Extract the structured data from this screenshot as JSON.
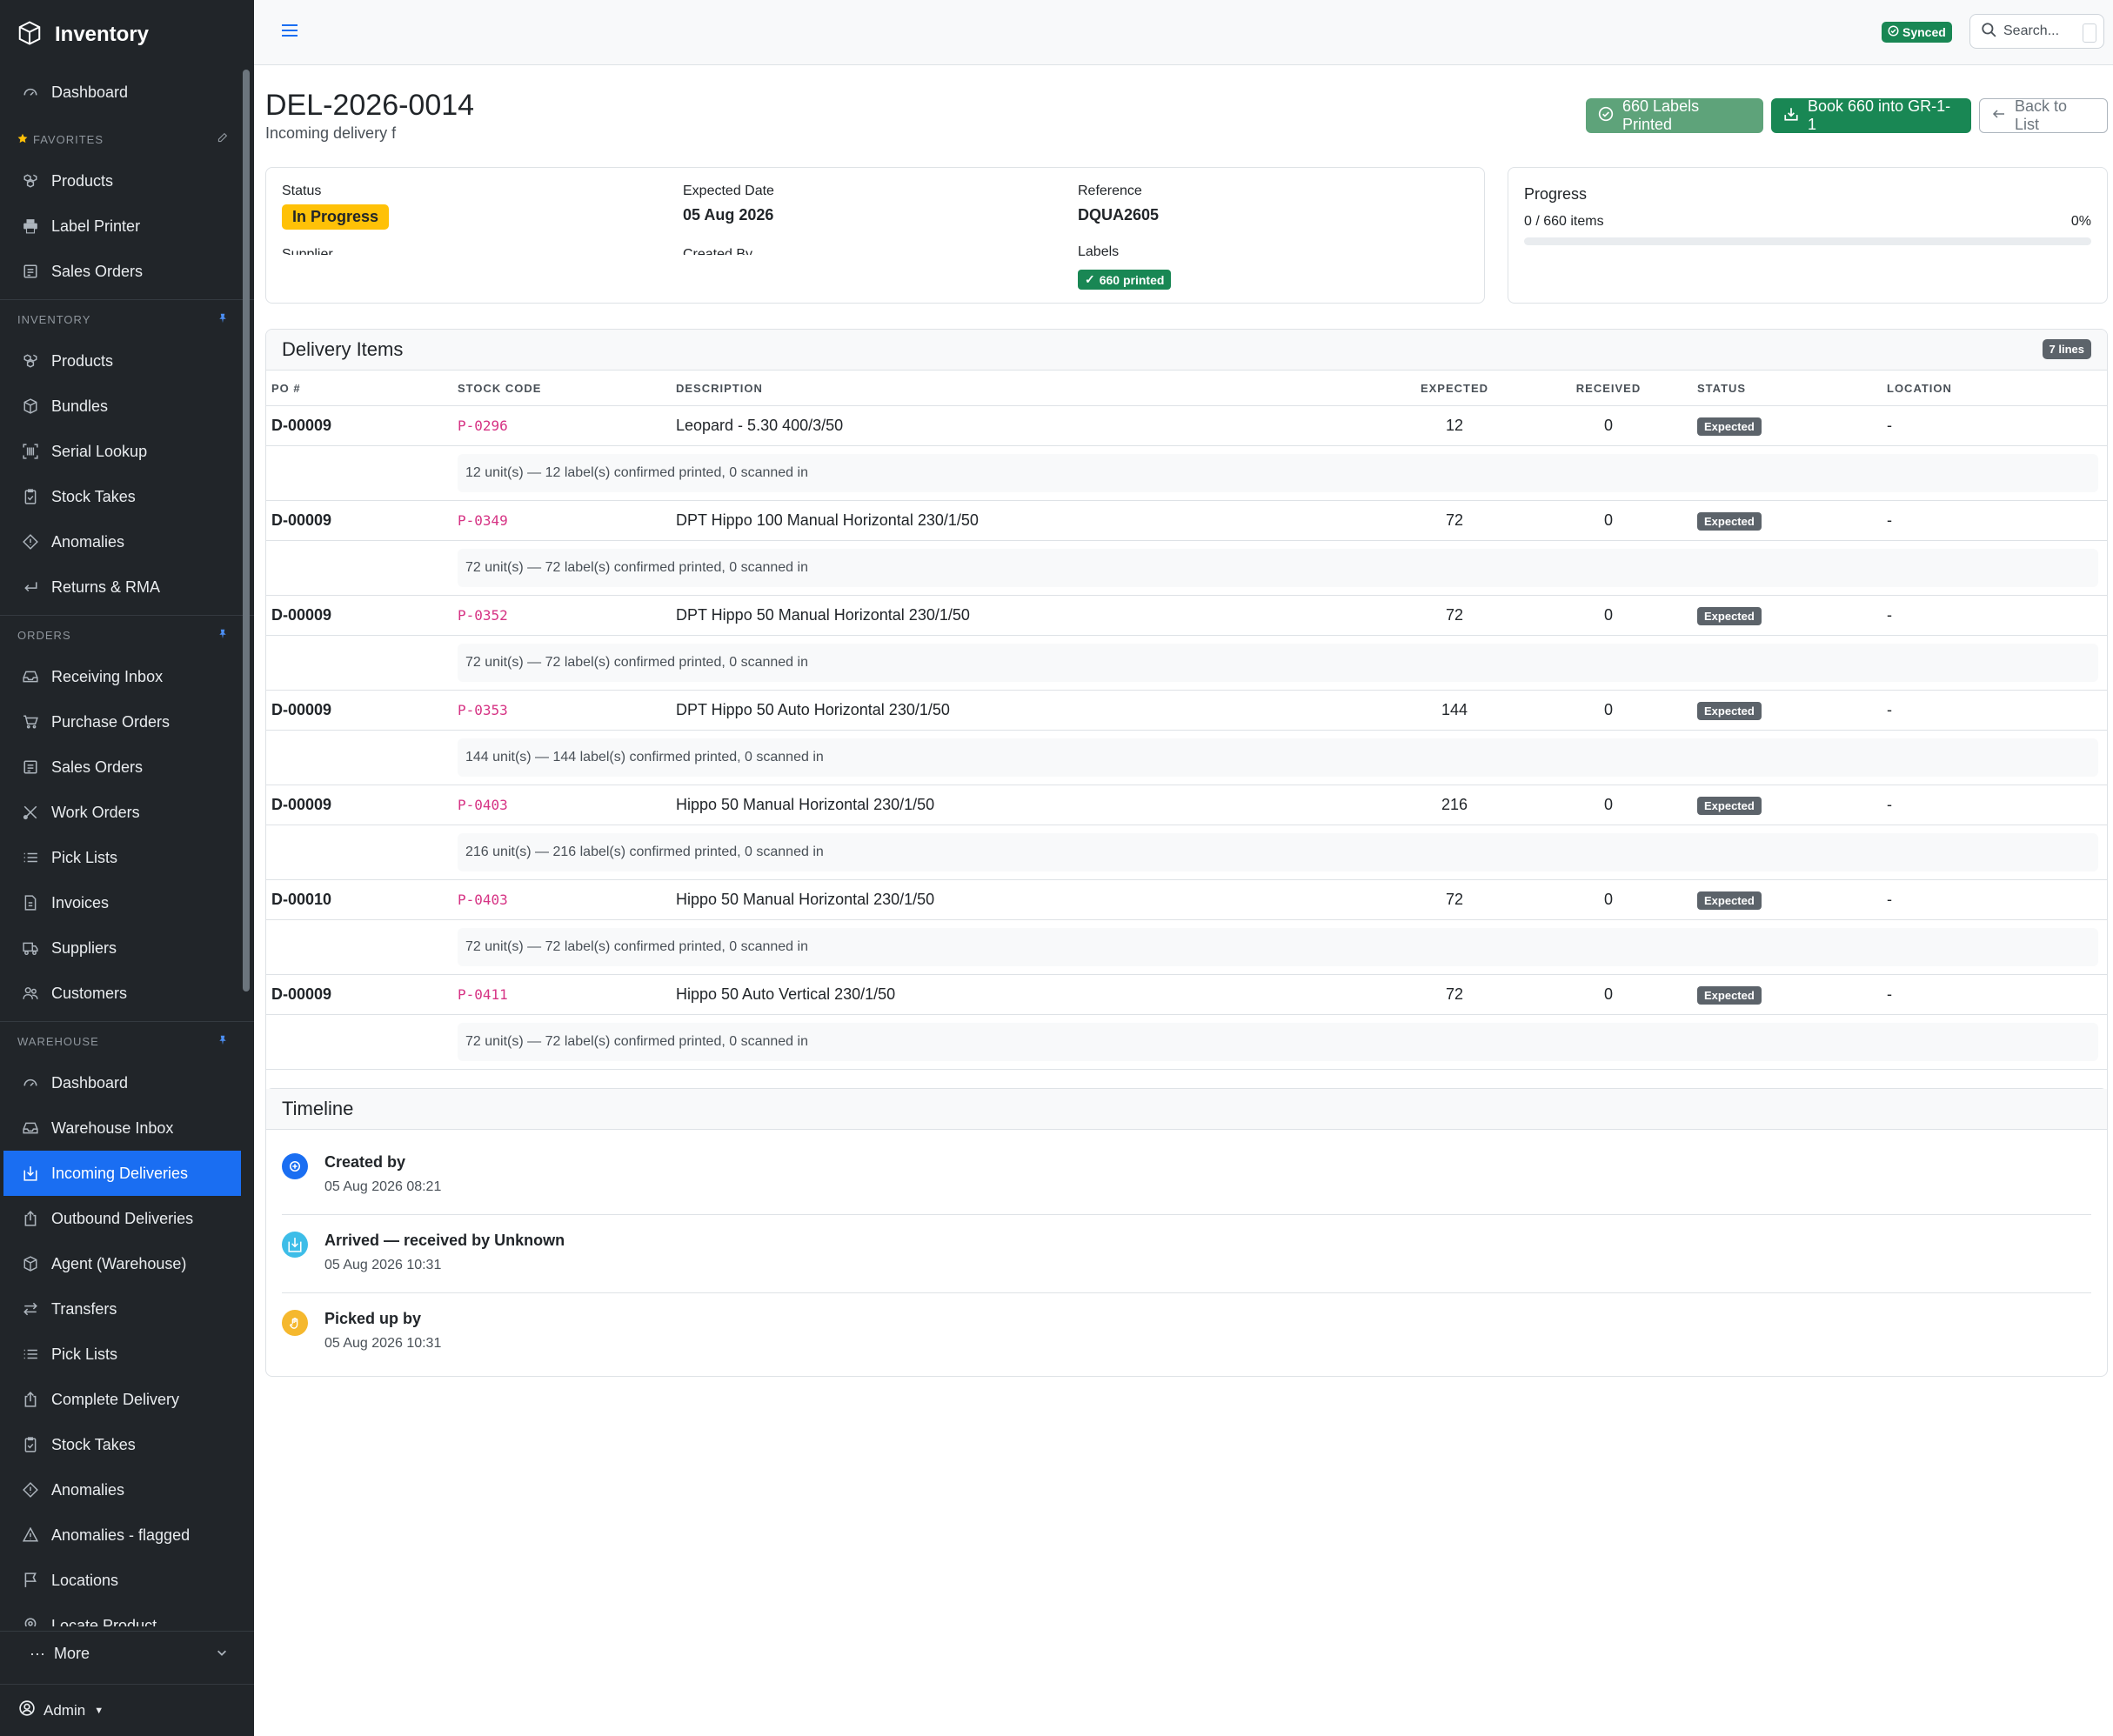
{
  "app": {
    "title": "Inventory"
  },
  "sidebar": {
    "top_items": [
      {
        "label": "Dashboard",
        "icon": "gauge-icon"
      }
    ],
    "favorites_label": "FAVORITES",
    "favorites": [
      {
        "label": "Products",
        "icon": "boxes-icon"
      },
      {
        "label": "Label Printer",
        "icon": "printer-icon"
      },
      {
        "label": "Sales Orders",
        "icon": "receipt-icon"
      }
    ],
    "inventory_label": "INVENTORY",
    "inventory": [
      {
        "label": "Products",
        "icon": "boxes-icon"
      },
      {
        "label": "Bundles",
        "icon": "box-icon"
      },
      {
        "label": "Serial Lookup",
        "icon": "barcode-icon"
      },
      {
        "label": "Stock Takes",
        "icon": "clipboard-check-icon"
      },
      {
        "label": "Anomalies",
        "icon": "diamond-alert-icon"
      },
      {
        "label": "Returns & RMA",
        "icon": "return-arrow-icon"
      }
    ],
    "orders_label": "ORDERS",
    "orders": [
      {
        "label": "Receiving Inbox",
        "icon": "inbox-icon"
      },
      {
        "label": "Purchase Orders",
        "icon": "cart-icon"
      },
      {
        "label": "Sales Orders",
        "icon": "receipt-icon"
      },
      {
        "label": "Work Orders",
        "icon": "tools-icon"
      },
      {
        "label": "Pick Lists",
        "icon": "list-icon"
      },
      {
        "label": "Invoices",
        "icon": "invoice-icon"
      },
      {
        "label": "Suppliers",
        "icon": "truck-icon"
      },
      {
        "label": "Customers",
        "icon": "people-icon"
      }
    ],
    "warehouse_label": "WAREHOUSE",
    "warehouse": [
      {
        "label": "Dashboard",
        "icon": "gauge-icon"
      },
      {
        "label": "Warehouse Inbox",
        "icon": "inbox-icon"
      },
      {
        "label": "Incoming Deliveries",
        "icon": "box-arrow-in-icon",
        "active": true
      },
      {
        "label": "Outbound Deliveries",
        "icon": "box-arrow-out-icon"
      },
      {
        "label": "Agent (Warehouse)",
        "icon": "box-icon"
      },
      {
        "label": "Transfers",
        "icon": "arrows-swap-icon"
      },
      {
        "label": "Pick Lists",
        "icon": "list-icon"
      },
      {
        "label": "Complete Delivery",
        "icon": "box-arrow-out-icon"
      },
      {
        "label": "Stock Takes",
        "icon": "clipboard-check-icon"
      },
      {
        "label": "Anomalies",
        "icon": "diamond-alert-icon"
      },
      {
        "label": "Anomalies - flagged",
        "icon": "warning-triangle-icon"
      },
      {
        "label": "Locations",
        "icon": "flag-icon"
      },
      {
        "label": "Locate Product",
        "icon": "map-pin-icon"
      }
    ],
    "more_label": "More",
    "admin_label": "Admin"
  },
  "topbar": {
    "synced_label": "Synced",
    "search_placeholder": "Search..."
  },
  "page": {
    "title": "DEL-2026-0014",
    "subtitle": "Incoming delivery f",
    "buttons": {
      "labels_printed": "660 Labels Printed",
      "book": "Book 660 into GR-1-1",
      "back": "Back to List"
    }
  },
  "info": {
    "status_label": "Status",
    "status_value": "In Progress",
    "expected_date_label": "Expected Date",
    "expected_date_value": "05 Aug 2026",
    "reference_label": "Reference",
    "reference_value": "DQUA2605",
    "supplier_label": "Supplier",
    "created_by_label": "Created By",
    "labels_label": "Labels",
    "labels_value": "660 printed"
  },
  "progress": {
    "title": "Progress",
    "count_text": "0 / 660 items",
    "percent_text": "0%",
    "fraction": 0
  },
  "items": {
    "title": "Delivery Items",
    "lines_badge": "7 lines",
    "columns": [
      "PO #",
      "STOCK CODE",
      "DESCRIPTION",
      "EXPECTED",
      "RECEIVED",
      "STATUS",
      "LOCATION"
    ],
    "rows": [
      {
        "po": "D-00009",
        "code": "P-0296",
        "description": "Leopard - 5.30 400/3/50",
        "expected": "12",
        "received": "0",
        "status": "Expected",
        "location": "-",
        "detail": "12 unit(s) — 12 label(s) confirmed printed, 0 scanned in"
      },
      {
        "po": "D-00009",
        "code": "P-0349",
        "description": "DPT Hippo 100 Manual Horizontal 230/1/50",
        "expected": "72",
        "received": "0",
        "status": "Expected",
        "location": "-",
        "detail": "72 unit(s) — 72 label(s) confirmed printed, 0 scanned in"
      },
      {
        "po": "D-00009",
        "code": "P-0352",
        "description": "DPT Hippo 50 Manual Horizontal 230/1/50",
        "expected": "72",
        "received": "0",
        "status": "Expected",
        "location": "-",
        "detail": "72 unit(s) — 72 label(s) confirmed printed, 0 scanned in"
      },
      {
        "po": "D-00009",
        "code": "P-0353",
        "description": "DPT Hippo 50 Auto Horizontal 230/1/50",
        "expected": "144",
        "received": "0",
        "status": "Expected",
        "location": "-",
        "detail": "144 unit(s) — 144 label(s) confirmed printed, 0 scanned in"
      },
      {
        "po": "D-00009",
        "code": "P-0403",
        "description": "Hippo 50 Manual Horizontal 230/1/50",
        "expected": "216",
        "received": "0",
        "status": "Expected",
        "location": "-",
        "detail": "216 unit(s) — 216 label(s) confirmed printed, 0 scanned in"
      },
      {
        "po": "D-00010",
        "code": "P-0403",
        "description": "Hippo 50 Manual Horizontal 230/1/50",
        "expected": "72",
        "received": "0",
        "status": "Expected",
        "location": "-",
        "detail": "72 unit(s) — 72 label(s) confirmed printed, 0 scanned in"
      },
      {
        "po": "D-00009",
        "code": "P-0411",
        "description": "Hippo 50 Auto Vertical 230/1/50",
        "expected": "72",
        "received": "0",
        "status": "Expected",
        "location": "-",
        "detail": "72 unit(s) — 72 label(s) confirmed printed, 0 scanned in"
      }
    ]
  },
  "timeline": {
    "title": "Timeline",
    "events": [
      {
        "title": "Created by",
        "time": "05 Aug 2026 08:21",
        "color": "#1a6ef2",
        "icon": "plus-circle-icon"
      },
      {
        "title": "Arrived — received by Unknown",
        "time": "05 Aug 2026 10:31",
        "color": "#3dbde8",
        "icon": "box-arrow-in-icon"
      },
      {
        "title": "Picked up by",
        "time": "05 Aug 2026 10:31",
        "color": "#f5b82e",
        "icon": "hand-icon"
      }
    ]
  },
  "colors": {
    "sidebar_bg": "#212529",
    "accent": "#1a6ef2",
    "success": "#198754",
    "warning": "#ffc107",
    "code_pink": "#d63384"
  }
}
